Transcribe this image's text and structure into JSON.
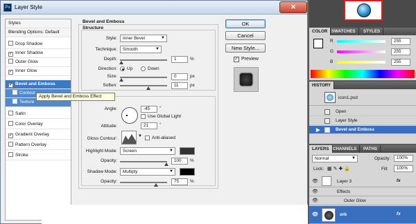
{
  "dialog": {
    "title": "Layer Style",
    "close_glyph": "✕",
    "styles_header": "Styles",
    "blending_options": "Blending Options: Default",
    "styles": [
      {
        "label": "Drop Shadow",
        "checked": false
      },
      {
        "label": "Inner Shadow",
        "checked": true
      },
      {
        "label": "Outer Glow",
        "checked": false
      },
      {
        "label": "Inner Glow",
        "checked": true
      },
      {
        "label": "Bevel and Emboss",
        "checked": true
      },
      {
        "label": "Contour",
        "checked": false
      },
      {
        "label": "Texture",
        "checked": false
      },
      {
        "label": "Satin",
        "checked": false
      },
      {
        "label": "Color Overlay",
        "checked": false
      },
      {
        "label": "Gradient Overlay",
        "checked": true
      },
      {
        "label": "Pattern Overlay",
        "checked": false
      },
      {
        "label": "Stroke",
        "checked": false
      }
    ],
    "tooltip": "Apply Bevel and Emboss Effect",
    "section_title": "Bevel and Emboss",
    "structure": {
      "label": "Structure",
      "style_label": "Style:",
      "style_value": "Inner Bevel",
      "technique_label": "Technique:",
      "technique_value": "Smooth",
      "depth_label": "Depth:",
      "depth_value": "1",
      "depth_unit": "%",
      "direction_label": "Direction:",
      "direction_up": "Up",
      "direction_down": "Down",
      "size_label": "Size:",
      "size_value": "0",
      "size_unit": "px",
      "soften_label": "Soften:",
      "soften_value": "11",
      "soften_unit": "px"
    },
    "shading": {
      "angle_label": "Angle:",
      "angle_value": "-45",
      "angle_unit": "°",
      "global_light_label": "Use Global Light",
      "altitude_label": "Altitude:",
      "altitude_value": "21",
      "altitude_unit": "°",
      "gloss_contour_label": "Gloss Contour:",
      "anti_aliased_label": "Anti-aliased",
      "highlight_mode_label": "Highlight Mode:",
      "highlight_mode_value": "Screen",
      "highlight_color": "#333333",
      "highlight_opacity_label": "Opacity:",
      "highlight_opacity_value": "100",
      "highlight_opacity_unit": "%",
      "shadow_mode_label": "Shadow Mode:",
      "shadow_mode_value": "Multiply",
      "shadow_color": "#000000",
      "shadow_opacity_label": "Opacity:",
      "shadow_opacity_value": "75",
      "shadow_opacity_unit": "%"
    },
    "buttons": {
      "ok": "OK",
      "cancel": "Cancel",
      "new_style": "New Style...",
      "preview": "Preview"
    }
  },
  "color_panel": {
    "tabs": [
      "COLOR",
      "SWATCHES",
      "STYLES"
    ],
    "channels": [
      {
        "label": "R",
        "value": "255"
      },
      {
        "label": "G",
        "value": "255"
      },
      {
        "label": "B",
        "value": "255"
      }
    ]
  },
  "history_panel": {
    "title": "HISTORY",
    "snapshot": "icon1.psd",
    "items": [
      "Open",
      "Layer Style",
      "Bevel and Emboss"
    ]
  },
  "layers_panel": {
    "tabs": [
      "LAYERS",
      "CHANNELS",
      "PATHS"
    ],
    "blend_mode": "Normal",
    "opacity_label": "Opacity:",
    "opacity_value": "100%",
    "lock_label": "Lock:",
    "fill_label": "Fill:",
    "fill_value": "100%",
    "layers": [
      {
        "name": "Layer 3",
        "effects_label": "Effects",
        "effect": "Outer Glow"
      },
      {
        "name": "orb"
      }
    ],
    "fx_glyph": "fx"
  }
}
